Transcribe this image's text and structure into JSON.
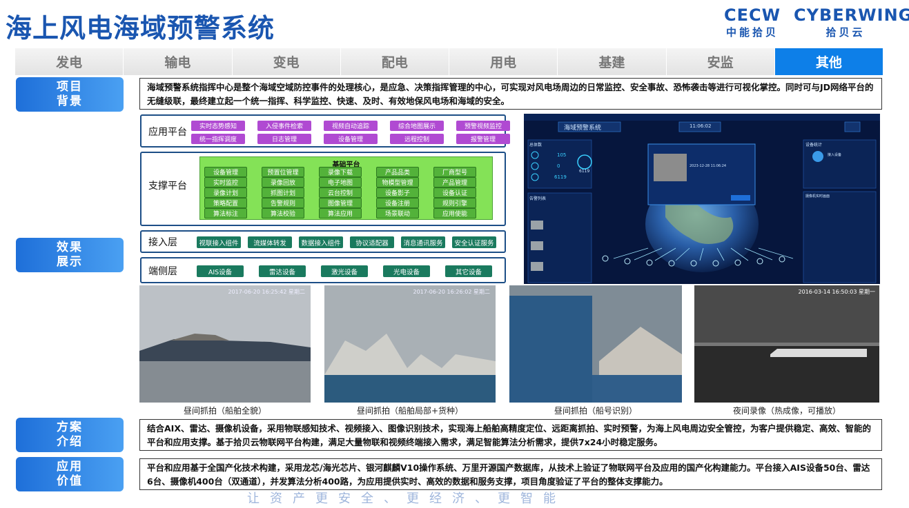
{
  "header": {
    "title": "海上风电海域预警系统",
    "logo_cecw": "CECW",
    "logo_cecw_cn": "中能拾贝",
    "logo_cyberwing": "CYBERWING",
    "logo_cyberwing_cn": "拾贝云"
  },
  "tabs": [
    "发电",
    "输电",
    "变电",
    "配电",
    "用电",
    "基建",
    "安监",
    "其他"
  ],
  "active_tab": "其他",
  "sections": {
    "background_label": "项目背景",
    "background_text": "海域预警系统指挥中心是整个海域空域防控事件的处理核心，是应急、决策指挥管理的中心，可实现对风电场周边的日常监控、安全事故、恐怖袭击等进行可视化掌控。同时可与JD网络平台的无缝级联，最终建立起一个统一指挥、科学监控、快速、及时、有效地保风电场和海域的安全。",
    "effect_label": "效果展示",
    "solution_label": "方案介绍",
    "solution_text": "结合AIX、雷达、摄像机设备，采用物联感知技术、视频接入、图像识别技术，实现海上船舶高精度定位、远距离抓拍、实时预警，为海上风电周边安全管控，为客户提供稳定、高效、智能的平台和应用支撑。基于拾贝云物联网平台构建，满足大量物联和视频终端接入需求，满足智能算法分析需求，提供7x24小时稳定服务。",
    "value_label": "应用价值",
    "value_text": "平台和应用基于全国产化技术构建，采用龙芯/海光芯片、银河麒麟V10操作系统、万里开源国产数据库，从技术上验证了物联网平台及应用的国产化构建能力。平台接入AIS设备50台、雷达6台、摄像机400台（双通道），并发算法分析400路，为应用提供实时、高效的数据和服务支撑，项目角度验证了平台的整体支撑能力。"
  },
  "architecture": {
    "app_layer": {
      "label": "应用平台",
      "items": [
        "实时态势感知",
        "入侵事件检索",
        "视频自动追踪",
        "综合地图展示",
        "预警视频监控",
        "统一指挥调度",
        "日志管理",
        "设备管理",
        "远程控制",
        "报警管理"
      ]
    },
    "support_layer": {
      "label": "支撑平台",
      "base_label": "基础平台",
      "items": [
        "设备管理",
        "预置位管理",
        "录像下载",
        "产品品类",
        "厂商型号",
        "实时监控",
        "录像回放",
        "电子地图",
        "物模型管理",
        "产品管理",
        "录像计划",
        "抓图计划",
        "云台控制",
        "设备影子",
        "设备认证",
        "策略配置",
        "告警规则",
        "图像管理",
        "设备注册",
        "规则引擎",
        "算法标注",
        "算法校验",
        "算法应用",
        "场景联动",
        "应用使能"
      ]
    },
    "access_layer": {
      "label": "接入层",
      "items": [
        "视联接入组件",
        "流媒体转发",
        "数据接入组件",
        "协议适配器",
        "消息通讯服务",
        "安全认证服务"
      ]
    },
    "edge_layer": {
      "label": "端侧层",
      "items": [
        "AIS设备",
        "雷达设备",
        "激光设备",
        "光电设备",
        "其它设备"
      ]
    }
  },
  "dashboard": {
    "title": "海域预警系统",
    "time": "11:06:02",
    "stat_label": "总体数",
    "stat_values": [
      "105",
      "0",
      "6119"
    ],
    "circle_value": "6119",
    "list_title": "告警列表",
    "right_title": "设备统计",
    "right_sub": "接入设备",
    "right_panel": "摄像机实时画面",
    "popup_time": "2023-12-28 11:06:24"
  },
  "photos": [
    {
      "stamp": "2017-06-20 16:25:42 星期二",
      "caption": "昼间抓拍（船舶全貌）"
    },
    {
      "stamp": "2017-06-20 16:26:02 星期二",
      "caption": "昼间抓拍（船舶局部+货种）"
    },
    {
      "stamp": "",
      "caption": "昼间抓拍（船号识别）"
    },
    {
      "stamp": "2016-03-14 16:50:03 星期一",
      "caption": "夜间录像（热成像，可播放）"
    }
  ],
  "slogan": "让资产更安全、更经济、更智能"
}
